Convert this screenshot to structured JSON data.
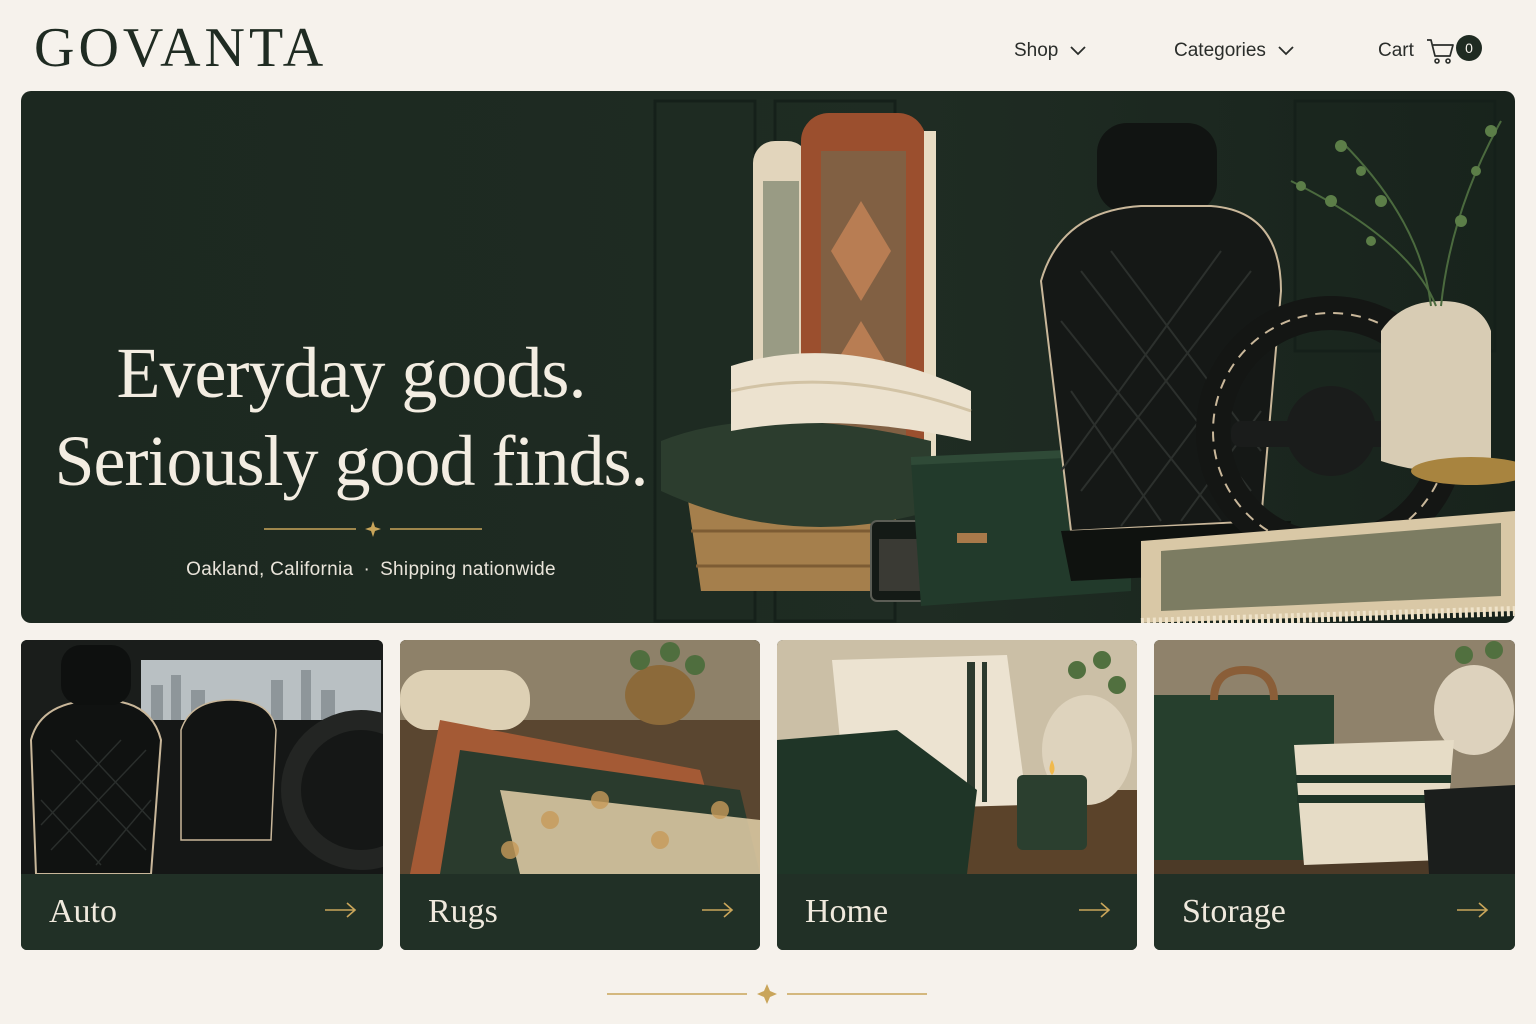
{
  "header": {
    "logo": "GOVANTA",
    "nav": {
      "shop_label": "Shop",
      "categories_label": "Categories",
      "cart_label": "Cart",
      "cart_count": "0"
    }
  },
  "hero": {
    "headline_line1": "Everyday goods.",
    "headline_line2": "Seriously good finds.",
    "location": "Oakland, California",
    "shipping": "Shipping nationwide"
  },
  "categories": [
    {
      "label": "Auto"
    },
    {
      "label": "Rugs"
    },
    {
      "label": "Home"
    },
    {
      "label": "Storage"
    }
  ],
  "colors": {
    "background": "#f6f2ec",
    "brand_green": "#1f2b22",
    "accent_gold": "#c9a55a",
    "text_light": "#f3ede2"
  },
  "icons": {
    "cart": "cart-icon",
    "chevron": "chevron-down-icon",
    "arrow": "arrow-right-icon",
    "ornament": "sparkle-divider-icon"
  }
}
